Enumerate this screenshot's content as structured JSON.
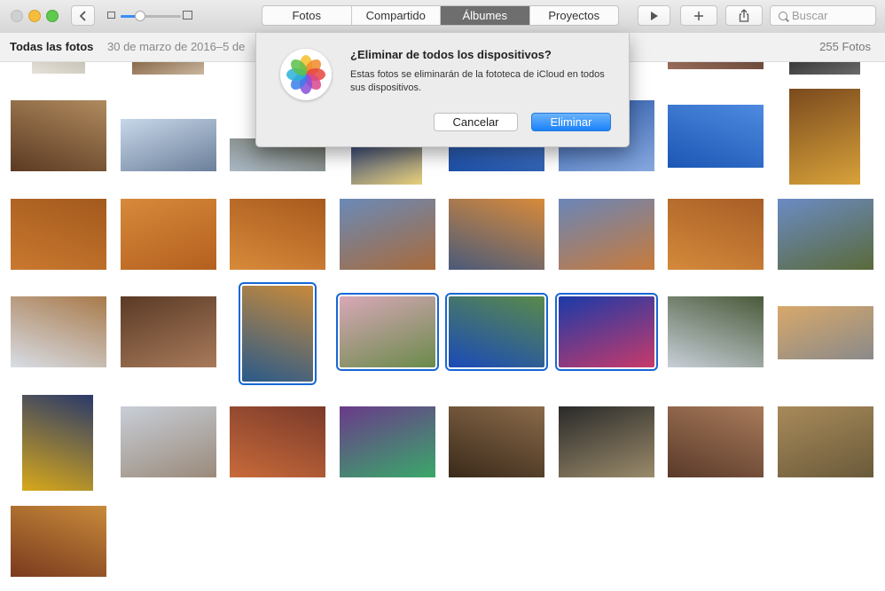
{
  "toolbar": {
    "tabs": [
      "Fotos",
      "Compartido",
      "Álbumes",
      "Proyectos"
    ],
    "active_tab": "Álbumes",
    "search_placeholder": "Buscar",
    "zoom_level": 0.33
  },
  "infobar": {
    "title": "Todas las fotos",
    "date_range": "30 de marzo de 2016–5 de",
    "count": "255 Fotos"
  },
  "dialog": {
    "title": "¿Eliminar de todos los dispositivos?",
    "message": "Estas fotos se eliminarán de la fototeca de iCloud en todos sus dispositivos.",
    "cancel_label": "Cancelar",
    "delete_label": "Eliminar"
  },
  "photos": [
    {
      "id": "p-r0-0",
      "subject": "sketch",
      "colors": [
        "#e6e2da",
        "#c9c4b8"
      ],
      "selected": false
    },
    {
      "id": "p-r0-1",
      "subject": "market",
      "colors": [
        "#8a6a4a",
        "#c9b7a0"
      ],
      "selected": false
    },
    {
      "id": "p-r0-2",
      "subject": "wall",
      "colors": [
        "#9a6c5c",
        "#6a4a3a"
      ],
      "selected": false
    },
    {
      "id": "p-r0-3",
      "subject": "dark",
      "colors": [
        "#3a3a3a",
        "#6a6a6a"
      ],
      "selected": false
    },
    {
      "id": "p-loom",
      "subject": "weaver at loom",
      "colors": [
        "#5b3a22",
        "#b08a5e"
      ],
      "selected": false
    },
    {
      "id": "p-town",
      "subject": "blue town view",
      "colors": [
        "#c8d8ea",
        "#6c7f9a"
      ],
      "selected": false
    },
    {
      "id": "p-town2",
      "subject": "town hills",
      "colors": [
        "#aab8c6",
        "#6b6e5e"
      ],
      "selected": false
    },
    {
      "id": "p-food1",
      "subject": "plate",
      "colors": [
        "#3b4b7a",
        "#e9d17a"
      ],
      "selected": false
    },
    {
      "id": "p-bluestair",
      "subject": "blue stairs",
      "colors": [
        "#1c4fa6",
        "#5a86d1"
      ],
      "selected": false
    },
    {
      "id": "p-bluewall",
      "subject": "blue wall",
      "colors": [
        "#2e5aa8",
        "#86a8de"
      ],
      "selected": false
    },
    {
      "id": "p-bluealley",
      "subject": "blue alley",
      "colors": [
        "#1b57b4",
        "#4f8ae0"
      ],
      "selected": false
    },
    {
      "id": "p-tagine",
      "subject": "tagine",
      "colors": [
        "#7a4a1e",
        "#d8a23a"
      ],
      "selected": false
    },
    {
      "id": "p-desert1",
      "subject": "desert guide",
      "colors": [
        "#c9782e",
        "#a35a1e"
      ],
      "selected": false
    },
    {
      "id": "p-desert2",
      "subject": "camel shadow",
      "colors": [
        "#d8893a",
        "#b3601f"
      ],
      "selected": false
    },
    {
      "id": "p-desert3",
      "subject": "dune shadows",
      "colors": [
        "#d88a3a",
        "#a85a1e"
      ],
      "selected": false
    },
    {
      "id": "p-desert4",
      "subject": "dusk dunes",
      "colors": [
        "#6a8ab8",
        "#a86a3a"
      ],
      "selected": false
    },
    {
      "id": "p-sunset1",
      "subject": "sunset",
      "colors": [
        "#4a5a7a",
        "#d88a3a"
      ],
      "selected": false
    },
    {
      "id": "p-sunset2",
      "subject": "sunrise",
      "colors": [
        "#6a86b8",
        "#c87a3a"
      ],
      "selected": false
    },
    {
      "id": "p-camels",
      "subject": "camels resting",
      "colors": [
        "#d48a3a",
        "#a85e26"
      ],
      "selected": false
    },
    {
      "id": "p-oasis",
      "subject": "oasis",
      "colors": [
        "#6b8bc4",
        "#5a6a3a"
      ],
      "selected": false
    },
    {
      "id": "p-kasbah",
      "subject": "kasbah hill",
      "colors": [
        "#d8dde6",
        "#a87a4a"
      ],
      "selected": false
    },
    {
      "id": "p-hands",
      "subject": "craftsman hands",
      "colors": [
        "#5a3a26",
        "#a87a5a"
      ],
      "selected": false
    },
    {
      "id": "p-pots",
      "subject": "ceramic bowls",
      "colors": [
        "#2a5a8a",
        "#c88a3a"
      ],
      "selected": true
    },
    {
      "id": "p-flowers",
      "subject": "white flowers",
      "colors": [
        "#d8a8b8",
        "#6a8a4a"
      ],
      "selected": true
    },
    {
      "id": "p-fountain",
      "subject": "garden fountain",
      "colors": [
        "#1a4ab8",
        "#5a8a4a"
      ],
      "selected": true
    },
    {
      "id": "p-bougain",
      "subject": "bougainvillea",
      "colors": [
        "#1a3aa8",
        "#c83a6a"
      ],
      "selected": true
    },
    {
      "id": "p-cactus",
      "subject": "cactus garden",
      "colors": [
        "#c8cfd8",
        "#4a5a3a"
      ],
      "selected": false
    },
    {
      "id": "p-street",
      "subject": "street cars",
      "colors": [
        "#d8a86a",
        "#8a8a8a"
      ],
      "selected": false
    },
    {
      "id": "p-snails",
      "subject": "snails bowl",
      "colors": [
        "#d8a81a",
        "#2a3a6a"
      ],
      "selected": false
    },
    {
      "id": "p-mosque",
      "subject": "mosque tower",
      "colors": [
        "#c8ced8",
        "#9a8a7a"
      ],
      "selected": false
    },
    {
      "id": "p-feast",
      "subject": "grilled food",
      "colors": [
        "#c86a3a",
        "#7a3a2a"
      ],
      "selected": false
    },
    {
      "id": "p-yarn",
      "subject": "colored yarn",
      "colors": [
        "#6a3a8a",
        "#3aa86a"
      ],
      "selected": false
    },
    {
      "id": "p-souk1",
      "subject": "souk alley",
      "colors": [
        "#3a2a1a",
        "#8a6a4a"
      ],
      "selected": false
    },
    {
      "id": "p-souk2",
      "subject": "covered souk",
      "colors": [
        "#2a2a2a",
        "#9a8a6a"
      ],
      "selected": false
    },
    {
      "id": "p-shop",
      "subject": "shop stall",
      "colors": [
        "#5a3a2a",
        "#a87a5a"
      ],
      "selected": false
    },
    {
      "id": "p-tannery",
      "subject": "tannery",
      "colors": [
        "#a88a5a",
        "#6a5a3a"
      ],
      "selected": false
    },
    {
      "id": "p-meal",
      "subject": "tagine meal",
      "colors": [
        "#7a3a1e",
        "#c88a3a"
      ],
      "selected": false
    }
  ]
}
